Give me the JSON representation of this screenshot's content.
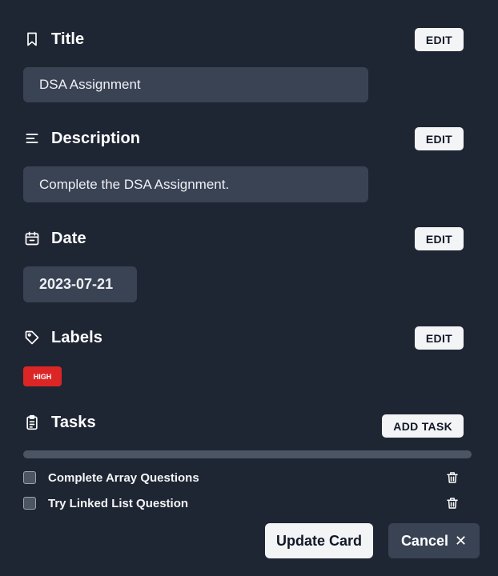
{
  "title_section": {
    "heading": "Title",
    "edit_label": "EDIT",
    "value": "DSA Assignment",
    "icon": "bookmark-icon"
  },
  "description_section": {
    "heading": "Description",
    "edit_label": "EDIT",
    "value": "Complete the DSA Assignment.",
    "icon": "text-align-icon"
  },
  "date_section": {
    "heading": "Date",
    "edit_label": "EDIT",
    "value": "2023-07-21",
    "icon": "calendar-icon"
  },
  "labels_section": {
    "heading": "Labels",
    "edit_label": "EDIT",
    "icon": "tag-icon",
    "labels": [
      {
        "text": "HIGH",
        "color": "#dc2626"
      }
    ]
  },
  "tasks_section": {
    "heading": "Tasks",
    "add_label": "ADD TASK",
    "icon": "clipboard-icon",
    "progress": 0,
    "tasks": [
      {
        "text": "Complete Array Questions",
        "checked": false
      },
      {
        "text": "Try Linked List Question",
        "checked": false
      }
    ]
  },
  "footer": {
    "update_label": "Update Card",
    "cancel_label": "Cancel",
    "cancel_glyph": "✕"
  },
  "colors": {
    "background": "#1f2633",
    "field": "#3a4354",
    "button_light": "#f3f4f6",
    "danger": "#dc2626"
  }
}
